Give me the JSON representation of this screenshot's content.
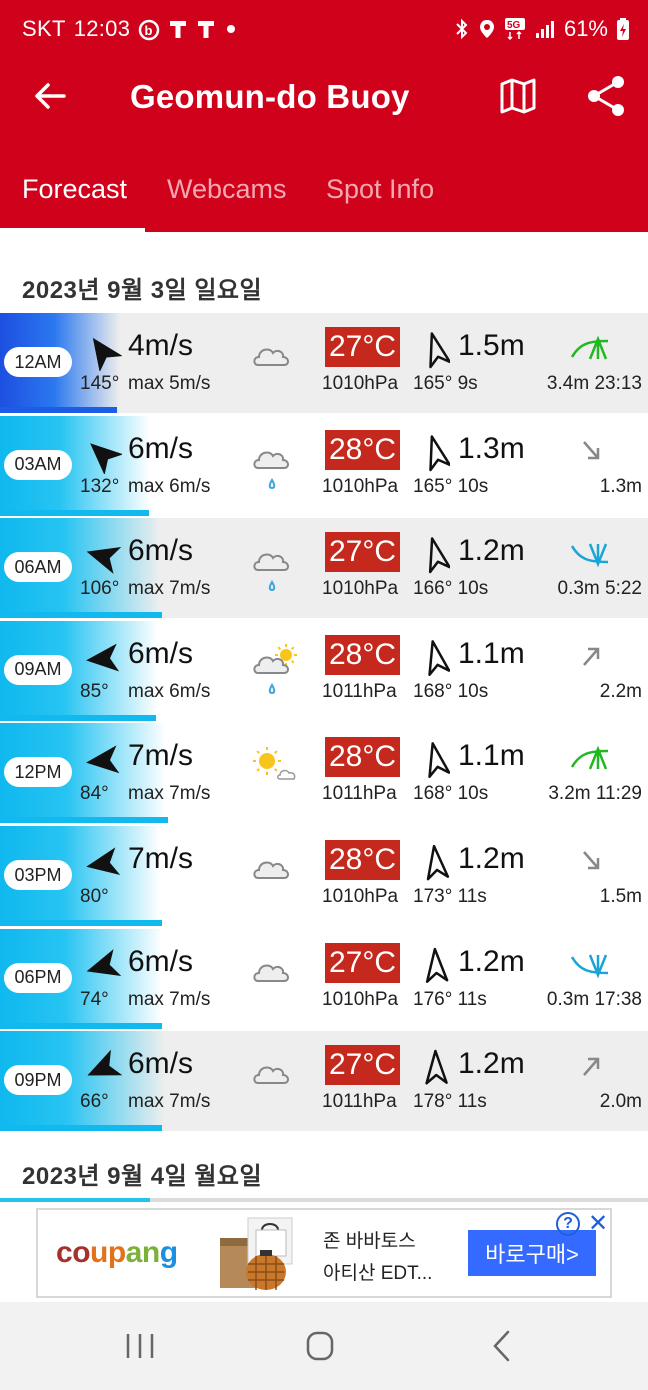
{
  "status_bar": {
    "carrier": "SKT",
    "time": "12:03",
    "battery": "61%",
    "icons": [
      "b-app-icon",
      "t-icon",
      "t-icon",
      "dot-icon",
      "bluetooth-icon",
      "location-icon",
      "5g-icon",
      "signal-icon",
      "battery-icon"
    ]
  },
  "app_bar": {
    "title": "Geomun-do Buoy",
    "back_icon": "arrow-left-icon",
    "map_icon": "map-icon",
    "share_icon": "share-icon"
  },
  "tabs": [
    {
      "label": "Forecast",
      "active": true
    },
    {
      "label": "Webcams",
      "active": false
    },
    {
      "label": "Spot Info",
      "active": false
    }
  ],
  "day1": {
    "date": "2023년 9월 3일 일요일",
    "rows": [
      {
        "time": "12AM",
        "wind_dir": 145,
        "wind_speed": "4m/s",
        "deg": "145°",
        "max": "max 5m/s",
        "gust_fraction": 0.18,
        "weather": "cloudy",
        "temp": "27°C",
        "pressure": "1010hPa",
        "swell_dir": 165,
        "swell": "1.5m",
        "swell_info": "165° 9s",
        "tide_icon": "high-tide-icon",
        "tide_text": "3.4m 23:13"
      },
      {
        "time": "03AM",
        "wind_dir": 132,
        "wind_speed": "6m/s",
        "deg": "132°",
        "max": "max 6m/s",
        "gust_fraction": 0.23,
        "weather": "cloudy-rain",
        "temp": "28°C",
        "pressure": "1010hPa",
        "swell_dir": 165,
        "swell": "1.3m",
        "swell_info": "165° 10s",
        "tide_icon": "falling-tide-icon",
        "tide_text": "1.3m"
      },
      {
        "time": "06AM",
        "wind_dir": 106,
        "wind_speed": "6m/s",
        "deg": "106°",
        "max": "max 7m/s",
        "gust_fraction": 0.25,
        "weather": "cloudy-rain",
        "temp": "27°C",
        "pressure": "1010hPa",
        "swell_dir": 166,
        "swell": "1.2m",
        "swell_info": "166° 10s",
        "tide_icon": "low-tide-icon",
        "tide_text": "0.3m 5:22"
      },
      {
        "time": "09AM",
        "wind_dir": 85,
        "wind_speed": "6m/s",
        "deg": "85°",
        "max": "max 6m/s",
        "gust_fraction": 0.24,
        "weather": "partly-sunny-rain",
        "temp": "28°C",
        "pressure": "1011hPa",
        "swell_dir": 168,
        "swell": "1.1m",
        "swell_info": "168° 10s",
        "tide_icon": "rising-tide-icon",
        "tide_text": "2.2m"
      },
      {
        "time": "12PM",
        "wind_dir": 84,
        "wind_speed": "7m/s",
        "deg": "84°",
        "max": "max 7m/s",
        "gust_fraction": 0.26,
        "weather": "sunny-cloud",
        "temp": "28°C",
        "pressure": "1011hPa",
        "swell_dir": 168,
        "swell": "1.1m",
        "swell_info": "168° 10s",
        "tide_icon": "high-tide-icon",
        "tide_text": "3.2m 11:29"
      },
      {
        "time": "03PM",
        "wind_dir": 80,
        "wind_speed": "7m/s",
        "deg": "80°",
        "max": "",
        "gust_fraction": 0.25,
        "weather": "cloudy",
        "temp": "28°C",
        "pressure": "1010hPa",
        "swell_dir": 173,
        "swell": "1.2m",
        "swell_info": "173° 11s",
        "tide_icon": "falling-tide-icon",
        "tide_text": "1.5m"
      },
      {
        "time": "06PM",
        "wind_dir": 74,
        "wind_speed": "6m/s",
        "deg": "74°",
        "max": "max 7m/s",
        "gust_fraction": 0.25,
        "weather": "cloudy",
        "temp": "27°C",
        "pressure": "1010hPa",
        "swell_dir": 176,
        "swell": "1.2m",
        "swell_info": "176° 11s",
        "tide_icon": "low-tide-icon",
        "tide_text": "0.3m 17:38"
      },
      {
        "time": "09PM",
        "wind_dir": 66,
        "wind_speed": "6m/s",
        "deg": "66°",
        "max": "max 7m/s",
        "gust_fraction": 0.25,
        "weather": "cloudy",
        "temp": "27°C",
        "pressure": "1011hPa",
        "swell_dir": 178,
        "swell": "1.2m",
        "swell_info": "178° 11s",
        "tide_icon": "rising-tide-icon",
        "tide_text": "2.0m"
      }
    ]
  },
  "day2": {
    "date": "2023년 9월 4일 월요일"
  },
  "ad": {
    "brand": "coupang",
    "brand_colors": [
      "#a5312c",
      "#e0731c",
      "#7bb03a",
      "#1b8fe0"
    ],
    "line1": "존 바바토스",
    "line2": "아티산 EDT...",
    "cta": "바로구매>",
    "help": "?",
    "close": "✕"
  },
  "colors": {
    "brand_red": "#d0011b",
    "temp_bg": "#c5281c",
    "wind_blue": "#12b9ef",
    "wind_dark_blue": "#1d5ce5",
    "tide_green": "#22b822",
    "tide_cyan": "#1aa5d8"
  },
  "nav": [
    "recent-apps-icon",
    "home-icon",
    "back-icon"
  ]
}
